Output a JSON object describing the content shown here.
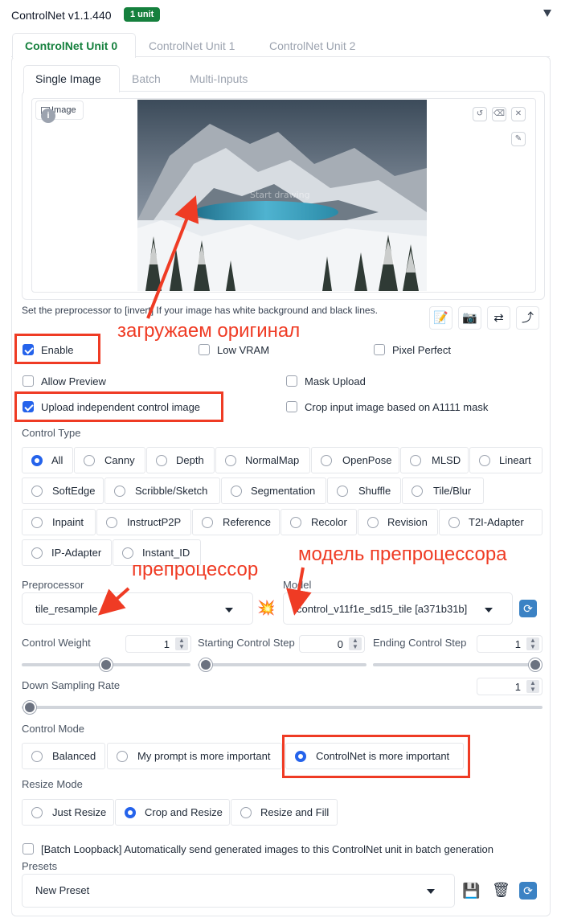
{
  "header": {
    "title": "ControlNet v1.1.440",
    "badge": "1 unit",
    "collapse_icon": "triangle-down-icon"
  },
  "unit_tabs": [
    "ControlNet Unit 0",
    "ControlNet Unit 1",
    "ControlNet Unit 2"
  ],
  "input_tabs": [
    "Single Image",
    "Batch",
    "Multi-Inputs"
  ],
  "image_panel": {
    "label": "Image",
    "overlay_text": "Start drawing"
  },
  "hint": "Set the preprocessor to [invert] If your image has white background and black lines.",
  "checkboxes": {
    "enable": {
      "label": "Enable",
      "checked": true
    },
    "low_vram": {
      "label": "Low VRAM",
      "checked": false
    },
    "pixel_perfect": {
      "label": "Pixel Perfect",
      "checked": false
    },
    "allow_preview": {
      "label": "Allow Preview",
      "checked": false
    },
    "mask_upload": {
      "label": "Mask Upload",
      "checked": false
    },
    "upload_independent": {
      "label": "Upload independent control image",
      "checked": true
    },
    "crop_input": {
      "label": "Crop input image based on A1111 mask",
      "checked": false
    }
  },
  "control_type": {
    "label": "Control Type",
    "selected": "All",
    "options": [
      "All",
      "Canny",
      "Depth",
      "NormalMap",
      "OpenPose",
      "MLSD",
      "Lineart",
      "SoftEdge",
      "Scribble/Sketch",
      "Segmentation",
      "Shuffle",
      "Tile/Blur",
      "Inpaint",
      "InstructP2P",
      "Reference",
      "Recolor",
      "Revision",
      "T2I-Adapter",
      "IP-Adapter",
      "Instant_ID"
    ]
  },
  "preprocessor": {
    "label": "Preprocessor",
    "value": "tile_resample"
  },
  "model": {
    "label": "Model",
    "value": "control_v11f1e_sd15_tile [a371b31b]"
  },
  "sliders": {
    "control_weight": {
      "label": "Control Weight",
      "value": "1",
      "fraction": 0.5
    },
    "starting_step": {
      "label": "Starting Control Step",
      "value": "0",
      "fraction": 0.0
    },
    "ending_step": {
      "label": "Ending Control Step",
      "value": "1",
      "fraction": 1.0
    },
    "down_sampling": {
      "label": "Down Sampling Rate",
      "value": "1",
      "fraction": 0.0
    }
  },
  "control_mode": {
    "label": "Control Mode",
    "options": [
      "Balanced",
      "My prompt is more important",
      "ControlNet is more important"
    ],
    "selected": "ControlNet is more important"
  },
  "resize_mode": {
    "label": "Resize Mode",
    "options": [
      "Just Resize",
      "Crop and Resize",
      "Resize and Fill"
    ],
    "selected": "Crop and Resize"
  },
  "batch_loopback": {
    "label": "[Batch Loopback] Automatically send generated images to this ControlNet unit in batch generation",
    "checked": false
  },
  "presets": {
    "label": "Presets",
    "value": "New Preset"
  },
  "annotations": {
    "original": "загружаем оригинал",
    "preprocessor": "препроцессор",
    "model": "модель препроцессора"
  },
  "colors": {
    "accent": "#15803d",
    "checked": "#2563eb",
    "annotation": "#ef3b24"
  }
}
